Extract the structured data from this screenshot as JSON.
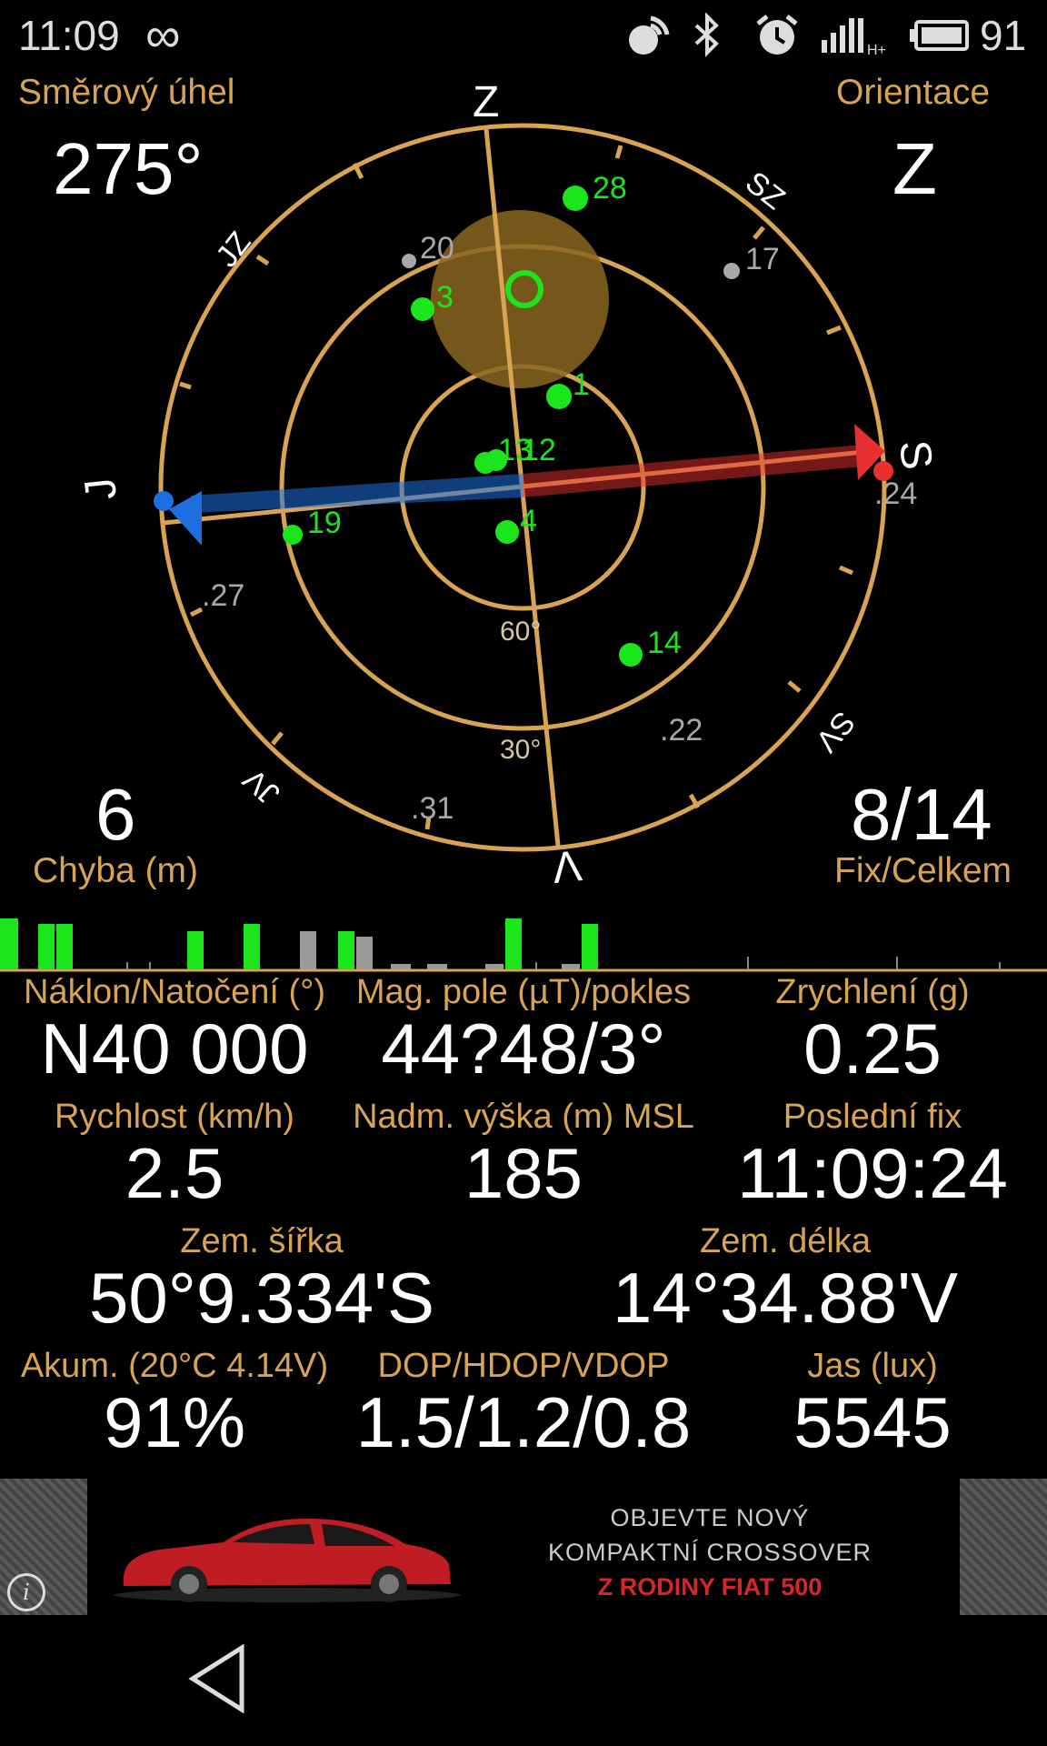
{
  "status": {
    "time": "11:09",
    "battery": "91",
    "icons": [
      "infinity-icon",
      "hotspot-icon",
      "bluetooth-icon",
      "alarm-icon",
      "signal-hplus-icon",
      "battery-icon"
    ]
  },
  "compass": {
    "heading_label": "Směrový úhel",
    "heading_value": "275°",
    "orientation_label": "Orientace",
    "orientation_value": "Z",
    "error_value": "6",
    "error_label": "Chyba (m)",
    "fix_value": "8/14",
    "fix_label": "Fix/Celkem",
    "directions": {
      "top": "Z",
      "right": "S",
      "bottom": "V",
      "left": "J",
      "nw": "JZ",
      "ne": "SZ",
      "se": "SV",
      "sw": "JV"
    },
    "elevation_labels": [
      "60°",
      "30°"
    ],
    "satellites_used": [
      "28",
      "3",
      "1",
      "13",
      "12",
      "4",
      "19",
      "14"
    ],
    "satellites_unused": [
      "20",
      "17",
      ".24",
      ".27",
      ".22",
      ".31"
    ],
    "colors": {
      "ring": "#d8a352",
      "sat_used": "#1be51b",
      "sat_unused": "#9a9a9a",
      "arrow_north": "#e83030",
      "arrow_south": "#1d6fe0"
    }
  },
  "stats": {
    "row1": [
      {
        "label": "Náklon/Natočení (°)",
        "value": "N40 000"
      },
      {
        "label": "Mag. pole (µT)/pokles",
        "value": "44?48/3°"
      },
      {
        "label": "Zrychlení (g)",
        "value": "0.25"
      }
    ],
    "row2": [
      {
        "label": "Rychlost (km/h)",
        "value": "2.5"
      },
      {
        "label": "Nadm. výška (m) MSL",
        "value": "185"
      },
      {
        "label": "Poslední fix",
        "value": "11:09:24"
      }
    ],
    "row3": [
      {
        "label": "Zem. šířka",
        "value": "50°9.334'S"
      },
      {
        "label": "Zem. délka",
        "value": "14°34.88'V"
      }
    ],
    "row4": [
      {
        "label": "Akum. (20°C 4.14V)",
        "value": "91%"
      },
      {
        "label": "DOP/HDOP/VDOP",
        "value": "1.5/1.2/0.8"
      },
      {
        "label": "Jas (lux)",
        "value": "5545"
      }
    ]
  },
  "ad": {
    "line1": "OBJEVTE NOVÝ",
    "line2": "KOMPAKTNÍ CROSSOVER",
    "line3": "Z RODINY FIAT 500",
    "info_icon": "info-icon"
  },
  "nav": {
    "back_icon": "back-triangle-icon"
  }
}
